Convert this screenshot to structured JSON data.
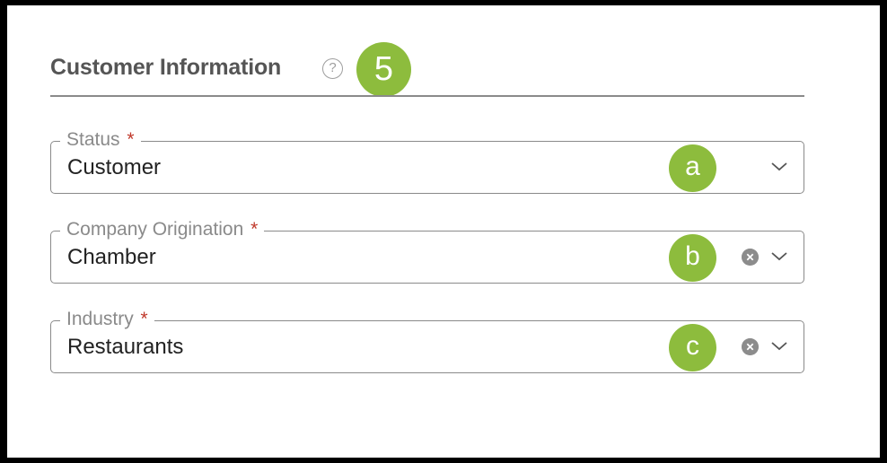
{
  "section": {
    "title": "Customer Information",
    "help_glyph": "?",
    "step_badge": "5"
  },
  "fields": [
    {
      "label": "Status",
      "required_mark": "*",
      "value": "Customer",
      "marker": "a",
      "clearable": false
    },
    {
      "label": "Company Origination",
      "required_mark": "*",
      "value": "Chamber",
      "marker": "b",
      "clearable": true
    },
    {
      "label": "Industry",
      "required_mark": "*",
      "value": "Restaurants",
      "marker": "c",
      "clearable": true
    }
  ],
  "icons": {
    "help": "question-circle-icon",
    "clear": "clear-x-icon",
    "dropdown": "chevron-down-icon"
  },
  "colors": {
    "badge_green": "#8dbc3d",
    "required_red": "#c0392b",
    "border_gray": "#8a8a8a"
  }
}
